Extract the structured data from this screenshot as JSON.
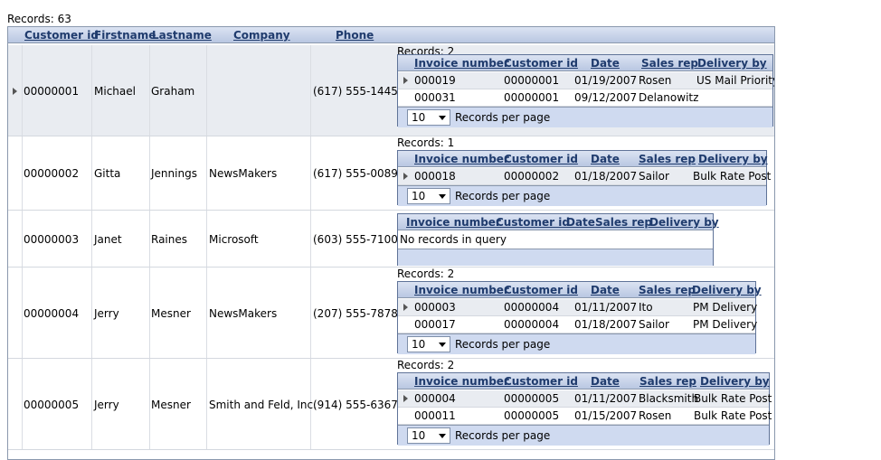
{
  "records_label": "Records:  63",
  "outer_columns": [
    "Customer id",
    "Firstname",
    "Lastname",
    "Company",
    "Phone"
  ],
  "detail_columns": [
    "Invoice number",
    "Customer id",
    "Date",
    "Sales rep",
    "Delivery by"
  ],
  "per_page_value": "10",
  "per_page_label": "Records per page",
  "no_records_text": "No records in query",
  "customers": [
    {
      "id": "00000001",
      "firstname": "Michael",
      "lastname": "Graham",
      "company": "",
      "phone": "(617) 555-1445",
      "records_label": "Records:  2",
      "invoices": [
        {
          "invoice": "000019",
          "customer": "00000001",
          "date": "01/19/2007",
          "rep": "Rosen",
          "delivery": "US Mail Priority"
        },
        {
          "invoice": "000031",
          "customer": "00000001",
          "date": "09/12/2007",
          "rep": "Delanowitz",
          "delivery": ""
        }
      ]
    },
    {
      "id": "00000002",
      "firstname": "Gitta",
      "lastname": "Jennings",
      "company": "NewsMakers",
      "phone": "(617) 555-0089",
      "records_label": "Records:  1",
      "invoices": [
        {
          "invoice": "000018",
          "customer": "00000002",
          "date": "01/18/2007",
          "rep": "Sailor",
          "delivery": "Bulk Rate Post"
        }
      ]
    },
    {
      "id": "00000003",
      "firstname": "Janet",
      "lastname": "Raines",
      "company": "Microsoft",
      "phone": "(603) 555-7100",
      "records_label": "",
      "invoices": []
    },
    {
      "id": "00000004",
      "firstname": "Jerry",
      "lastname": "Mesner",
      "company": "NewsMakers",
      "phone": "(207) 555-7878",
      "records_label": "Records:  2",
      "invoices": [
        {
          "invoice": "000003",
          "customer": "00000004",
          "date": "01/11/2007",
          "rep": "Ito",
          "delivery": "PM Delivery"
        },
        {
          "invoice": "000017",
          "customer": "00000004",
          "date": "01/18/2007",
          "rep": "Sailor",
          "delivery": "PM Delivery"
        }
      ]
    },
    {
      "id": "00000005",
      "firstname": "Jerry",
      "lastname": "Mesner",
      "company": "Smith and Feld, Inc.",
      "phone": "(914) 555-6367",
      "records_label": "Records:  2",
      "invoices": [
        {
          "invoice": "000004",
          "customer": "00000005",
          "date": "01/11/2007",
          "rep": "Blacksmith",
          "delivery": "Bulk Rate Post"
        },
        {
          "invoice": "000011",
          "customer": "00000005",
          "date": "01/15/2007",
          "rep": "Rosen",
          "delivery": "Bulk Rate Post"
        }
      ]
    }
  ]
}
